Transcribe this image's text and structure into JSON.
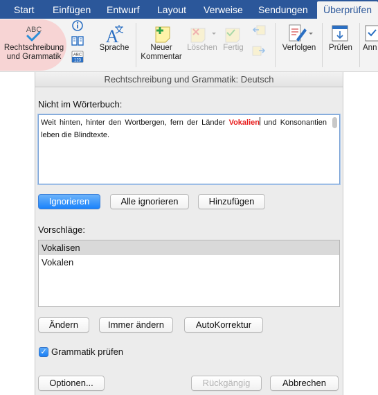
{
  "tabs": [
    {
      "label": "Start",
      "active": false
    },
    {
      "label": "Einfügen",
      "active": false
    },
    {
      "label": "Entwurf",
      "active": false
    },
    {
      "label": "Layout",
      "active": false
    },
    {
      "label": "Verweise",
      "active": false
    },
    {
      "label": "Sendungen",
      "active": false
    },
    {
      "label": "Überprüfen",
      "active": true
    }
  ],
  "ribbon": {
    "spelling_icon_text": "ABC",
    "spelling_line1": "Rechtschreibung",
    "spelling_line2": "und Grammatik",
    "wordcount_icon_text": "ABC 123",
    "sprache": "Sprache",
    "neuer": "Neuer",
    "kommentar": "Kommentar",
    "loeschen": "Löschen",
    "fertig": "Fertig",
    "verfolgen": "Verfolgen",
    "pruefen": "Prüfen",
    "annehmen": "Ann"
  },
  "dialog": {
    "title": "Rechtschreibung und Grammatik: Deutsch",
    "not_in_dict_label": "Nicht im Wörterbuch:",
    "text_before": "Weit hinten, hinter den Wortbergen, fern der Länder ",
    "text_error": "Vokalien",
    "text_after": " und Konsonantien leben die Blindtexte.",
    "btn_ignore": "Ignorieren",
    "btn_ignore_all": "Alle ignorieren",
    "btn_add": "Hinzufügen",
    "suggestions_label": "Vorschläge:",
    "suggestions": [
      "Vokalisen",
      "Vokalen"
    ],
    "btn_change": "Ändern",
    "btn_change_all": "Immer ändern",
    "btn_autocorrect": "AutoKorrektur",
    "check_grammar": "Grammatik prüfen",
    "check_grammar_checked": true,
    "btn_options": "Optionen...",
    "btn_undo": "Rückgängig",
    "btn_cancel": "Abbrechen"
  },
  "colors": {
    "ribbon_blue": "#2b579a",
    "error_red": "#e81c1c",
    "accent_blue": "#1a82fb"
  }
}
